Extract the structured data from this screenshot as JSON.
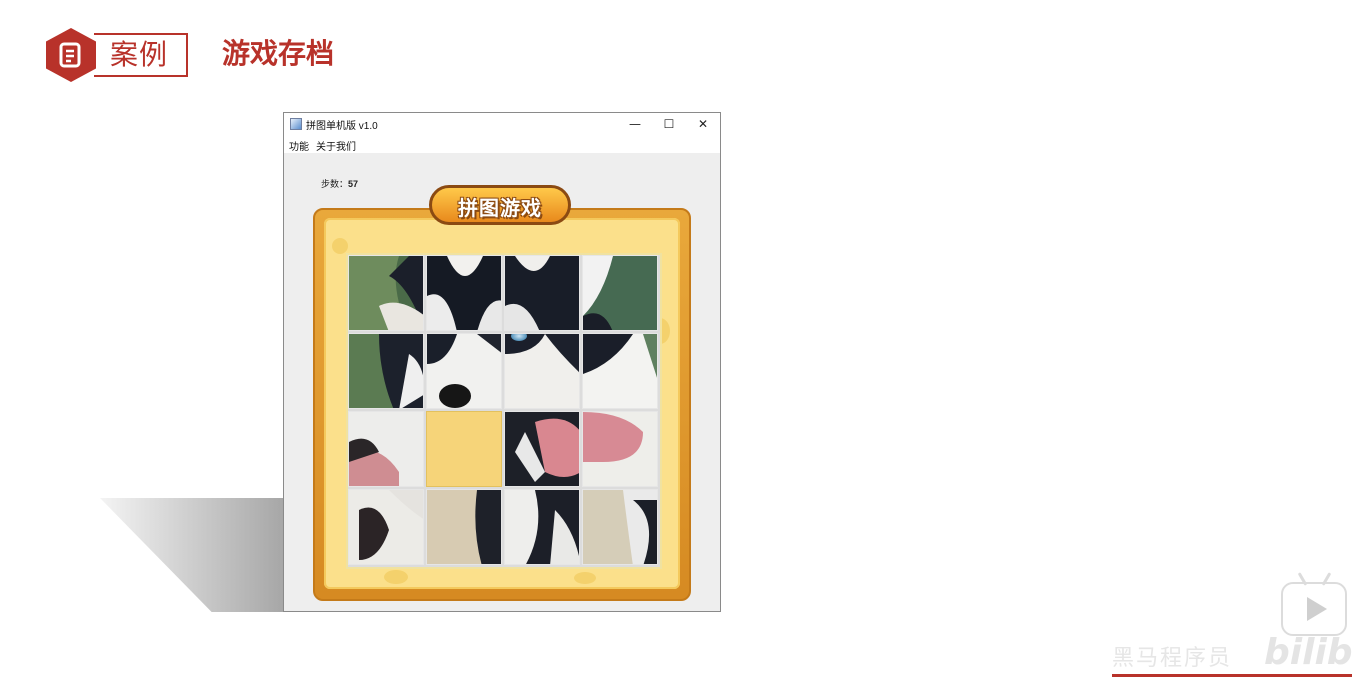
{
  "header": {
    "section_label": "案例",
    "title": "游戏存档"
  },
  "window": {
    "title": "拼图单机版 v1.0",
    "controls": {
      "minimize": "—",
      "maximize": "☐",
      "close": "✕"
    },
    "menu": [
      "功能",
      "关于我们"
    ]
  },
  "game": {
    "steps_label": "步数：",
    "steps_value": "57",
    "banner": "拼图游戏",
    "empty_tile": {
      "row": 3,
      "col": 2
    },
    "colors": {
      "frame": "#e9a83b",
      "board_bg": "#fbe08b",
      "empty_tile": "#f6d479"
    }
  },
  "watermark": {
    "text": "黑马程序员",
    "logo": "bilibili"
  },
  "colors": {
    "accent": "#b8322a"
  }
}
